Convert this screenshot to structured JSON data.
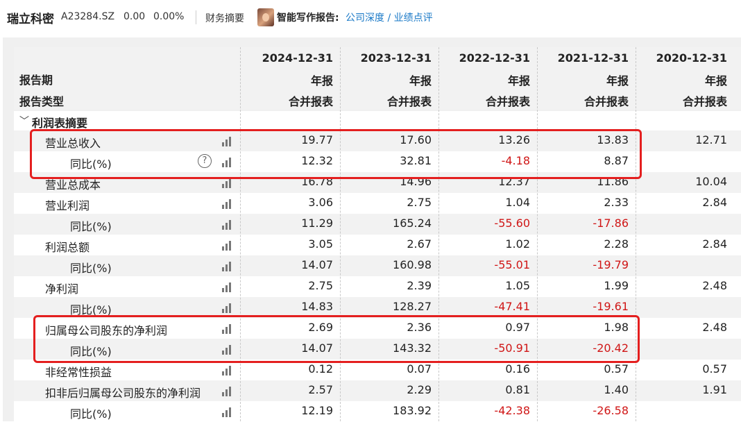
{
  "header": {
    "stock_name": "瑞立科密",
    "stock_code": "A23284.SZ",
    "price": "0.00",
    "change_pct": "0.00%",
    "fin_summary_tab": "财务摘要",
    "ai_report_label": "智能写作报告:",
    "ai_report_link": "公司深度 / 业绩点评"
  },
  "table_header": {
    "row1_label": "",
    "row2_label": "报告期",
    "row3_label": "报告类型",
    "columns": [
      {
        "date": "2024-12-31",
        "period": "年报",
        "type": "合并报表"
      },
      {
        "date": "2023-12-31",
        "period": "年报",
        "type": "合并报表"
      },
      {
        "date": "2022-12-31",
        "period": "年报",
        "type": "合并报表"
      },
      {
        "date": "2021-12-31",
        "period": "年报",
        "type": "合并报表"
      },
      {
        "date": "2020-12-31",
        "period": "年报",
        "type": "合并报表"
      }
    ]
  },
  "section": {
    "title": "利润表摘要"
  },
  "rows": [
    {
      "label": "营业总收入",
      "indent": 1,
      "help": false,
      "values": [
        "19.77",
        "17.60",
        "13.26",
        "13.83",
        "12.71"
      ]
    },
    {
      "label": "同比(%)",
      "indent": 2,
      "help": true,
      "values": [
        "12.32",
        "32.81",
        "-4.18",
        "8.87",
        ""
      ]
    },
    {
      "label": "营业总成本",
      "indent": 1,
      "help": false,
      "values": [
        "16.78",
        "14.96",
        "12.37",
        "11.86",
        "10.04"
      ]
    },
    {
      "label": "营业利润",
      "indent": 1,
      "help": false,
      "values": [
        "3.06",
        "2.75",
        "1.04",
        "2.33",
        "2.84"
      ]
    },
    {
      "label": "同比(%)",
      "indent": 2,
      "help": false,
      "values": [
        "11.29",
        "165.24",
        "-55.60",
        "-17.86",
        ""
      ]
    },
    {
      "label": "利润总额",
      "indent": 1,
      "help": false,
      "values": [
        "3.05",
        "2.67",
        "1.02",
        "2.28",
        "2.84"
      ]
    },
    {
      "label": "同比(%)",
      "indent": 2,
      "help": false,
      "values": [
        "14.07",
        "160.98",
        "-55.01",
        "-19.79",
        ""
      ]
    },
    {
      "label": "净利润",
      "indent": 1,
      "help": false,
      "values": [
        "2.75",
        "2.39",
        "1.05",
        "1.99",
        "2.48"
      ]
    },
    {
      "label": "同比(%)",
      "indent": 2,
      "help": false,
      "values": [
        "14.83",
        "128.27",
        "-47.41",
        "-19.61",
        ""
      ]
    },
    {
      "label": "归属母公司股东的净利润",
      "indent": 1,
      "help": false,
      "values": [
        "2.69",
        "2.36",
        "0.97",
        "1.98",
        "2.48"
      ]
    },
    {
      "label": "同比(%)",
      "indent": 2,
      "help": false,
      "values": [
        "14.07",
        "143.32",
        "-50.91",
        "-20.42",
        ""
      ]
    },
    {
      "label": "非经常性损益",
      "indent": 1,
      "help": false,
      "values": [
        "0.12",
        "0.07",
        "0.16",
        "0.57",
        "0.57"
      ]
    },
    {
      "label": "扣非后归属母公司股东的净利润",
      "indent": 1,
      "help": false,
      "values": [
        "2.57",
        "2.29",
        "0.81",
        "1.40",
        "1.91"
      ]
    },
    {
      "label": "同比(%)",
      "indent": 2,
      "help": false,
      "values": [
        "12.19",
        "183.92",
        "-42.38",
        "-26.58",
        ""
      ]
    }
  ],
  "colors": {
    "negative": "#d01616",
    "highlight_box": "#e41f1f",
    "link": "#1a79c7"
  },
  "icons": {
    "row_chart": "bar-chart-icon",
    "help": "question-circle-icon",
    "section_toggle": "chevron-down-icon"
  }
}
